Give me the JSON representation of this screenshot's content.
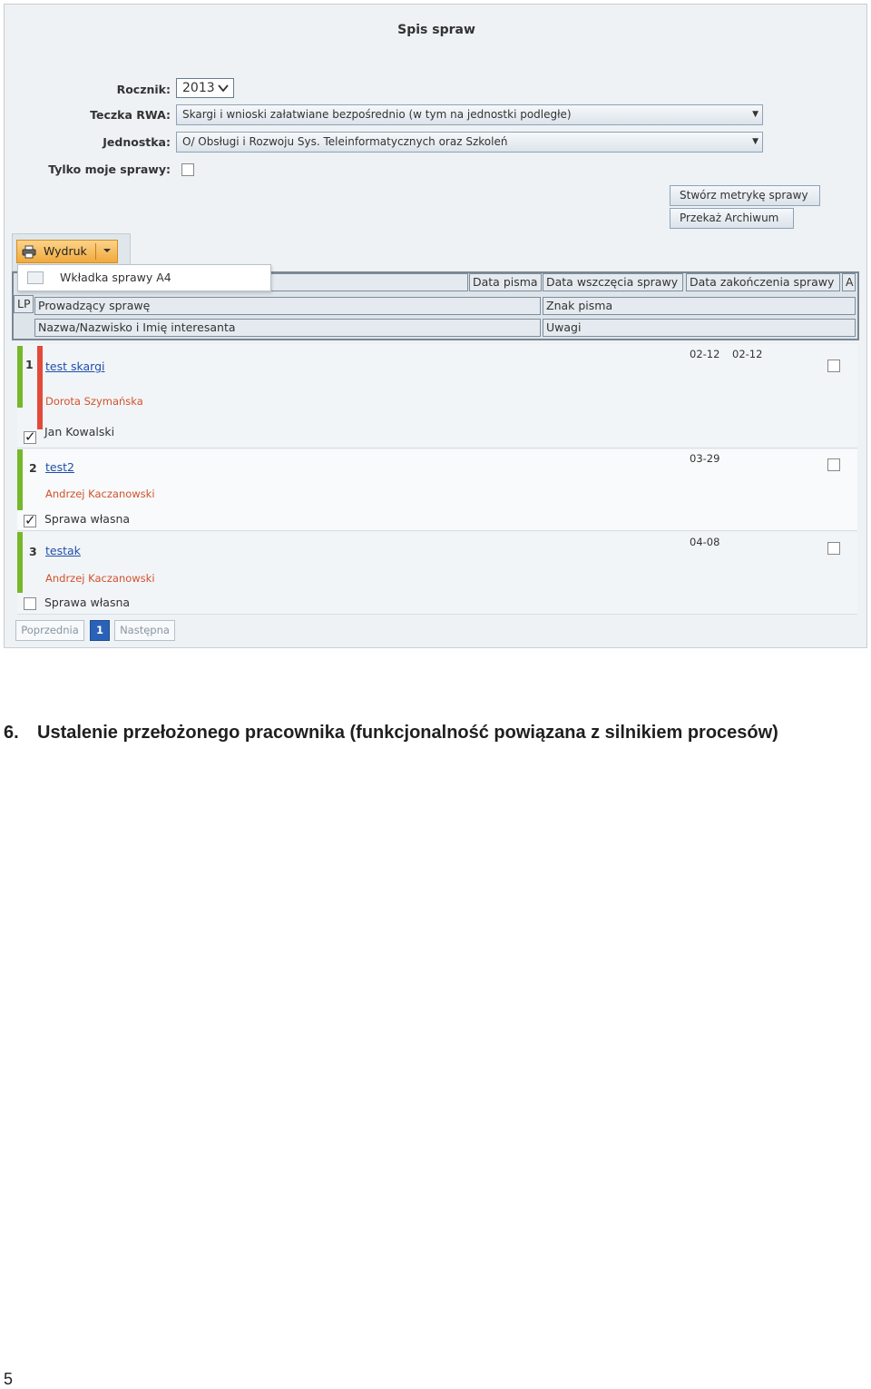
{
  "screen": {
    "title": "Spis spraw",
    "filters": {
      "rocznik_label": "Rocznik:",
      "rocznik_value": "2013",
      "teczka_label": "Teczka RWA:",
      "teczka_value": "Skargi i wnioski załatwiane bezpośrednio (w tym na jednostki podległe)",
      "jednostka_label": "Jednostka:",
      "jednostka_value": "O/ Obsługi i Rozwoju Sys. Teleinformatycznych oraz Szkoleń",
      "tylko_label": "Tylko moje sprawy:"
    },
    "actions": {
      "create_label": "Stwórz metrykę sprawy",
      "archive_label": "Przekaż Archiwum"
    },
    "toolbar": {
      "print_label": "Wydruk",
      "menu_item": "Wkładka sprawy A4"
    },
    "columns": {
      "lp": "LP",
      "data_pisma": "Data pisma",
      "data_wszczecia": "Data wszczęcia sprawy",
      "data_zakonczenia": "Data zakończenia sprawy",
      "a": "A",
      "prowadzacy": "Prowadzący sprawę",
      "znak": "Znak pisma",
      "nazwa": "Nazwa/Nazwisko i Imię interesanta",
      "uwagi": "Uwagi"
    },
    "rows": [
      {
        "lp": "1",
        "title": "test skargi",
        "person": "Dorota Szymańska",
        "interesant": "Jan Kowalski",
        "date_start": "02-12",
        "date_end": "02-12"
      },
      {
        "lp": "2",
        "title": "test2",
        "person": "Andrzej Kaczanowski",
        "interesant": "Sprawa własna",
        "date_start": "03-29",
        "date_end": ""
      },
      {
        "lp": "3",
        "title": "testak",
        "person": "Andrzej Kaczanowski",
        "interesant": "Sprawa własna",
        "date_start": "04-08",
        "date_end": ""
      }
    ],
    "pagination": {
      "prev": "Poprzednia",
      "page": "1",
      "next": "Następna"
    }
  },
  "document": {
    "heading_number": "6.",
    "heading_text": "Ustalenie przełożonego pracownika (funkcjonalność powiązana z silnikiem procesów)",
    "page_number": "5"
  }
}
